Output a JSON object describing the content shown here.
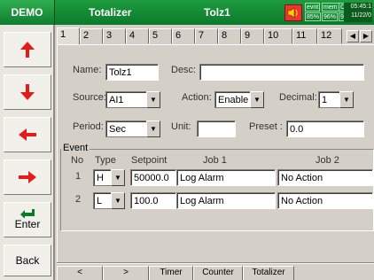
{
  "titlebar": {
    "mode": "DEMO",
    "screen_name": "Totalizer",
    "tag_name": "Tolz1",
    "speaker_icon": "speaker-icon",
    "status": {
      "evnt_label": "evnt",
      "evnt_value": "85%",
      "mem_label": "mem",
      "mem_value": "96%",
      "cf_label": "CF",
      "cf_value": "94%",
      "time": "05:45:1",
      "date": "11/22/0"
    }
  },
  "sidebar": {
    "up_icon": "up-arrow-icon",
    "down_icon": "down-arrow-icon",
    "left_icon": "left-arrow-icon",
    "right_icon": "right-arrow-icon",
    "enter_icon": "enter-icon",
    "enter_label": "Enter",
    "back_label": "Back"
  },
  "tabs": [
    "1",
    "2",
    "3",
    "4",
    "5",
    "6",
    "7",
    "8",
    "9",
    "10",
    "11",
    "12"
  ],
  "tab_nav": {
    "prev": "◀",
    "next": "▶"
  },
  "form": {
    "name_label": "Name:",
    "name_value": "Tolz1",
    "desc_label": "Desc:",
    "desc_value": "",
    "source_label": "Source:",
    "source_value": "AI1",
    "action_label": "Action:",
    "action_value": "Enable",
    "decimal_label": "Decimal:",
    "decimal_value": "1",
    "period_label": "Period:",
    "period_value": "Sec",
    "unit_label": "Unit:",
    "unit_value": "",
    "preset_label": "Preset :",
    "preset_value": "0.0"
  },
  "event": {
    "title": "Event",
    "headers": {
      "no": "No",
      "type": "Type",
      "setpoint": "Setpoint",
      "job1": "Job 1",
      "job2": "Job 2"
    },
    "rows": [
      {
        "no": "1",
        "type": "H",
        "setpoint": "50000.0",
        "job1": "Log Alarm",
        "job2": "No Action"
      },
      {
        "no": "2",
        "type": "L",
        "setpoint": "100.0",
        "job1": "Log Alarm",
        "job2": "No Action"
      }
    ]
  },
  "bottom_tabs": [
    "<",
    ">",
    "Timer",
    "Counter",
    "Totalizer"
  ],
  "dropdown_glyph": "▼"
}
